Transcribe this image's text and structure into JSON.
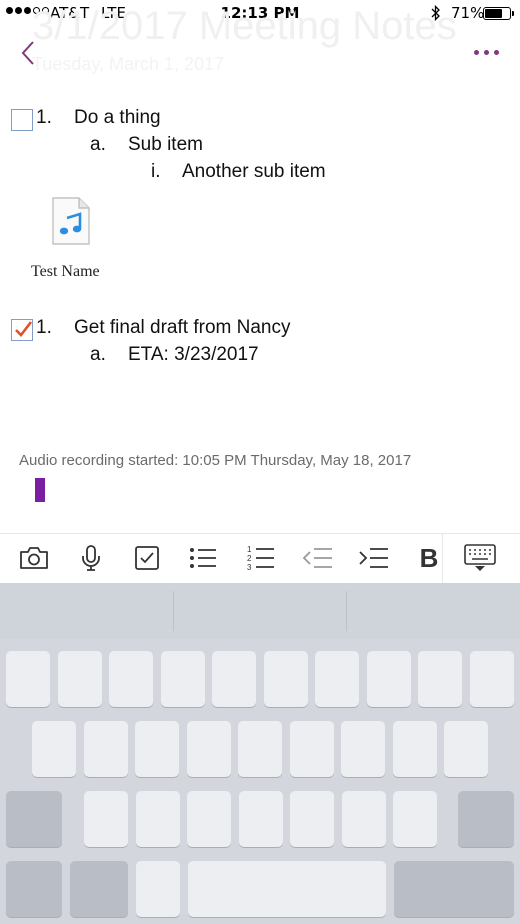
{
  "status_bar": {
    "carrier": "AT&T",
    "network": "LTE",
    "time": "12:13 PM",
    "battery_percent": "71%",
    "battery_level": 0.71,
    "bluetooth_icon": "bluetooth-icon"
  },
  "page": {
    "ghost_title": "3/1/2017 Meeting Notes",
    "ghost_subtitle": "Tuesday, March 1, 2017"
  },
  "nav": {
    "back_icon": "chevron-left-icon",
    "more_icon": "ellipsis-icon",
    "accent_color": "#80397b"
  },
  "note": {
    "todo1": {
      "number": "1.",
      "text": "Do a thing",
      "checked": false
    },
    "sub_a": {
      "marker": "a.",
      "text": "Sub item"
    },
    "sub_i": {
      "marker": "i.",
      "text": "Another sub item"
    },
    "attachment": {
      "icon": "audio-file-icon",
      "name": "Test Name"
    },
    "todo2": {
      "number": "1.",
      "text": "Get final draft from Nancy",
      "checked": true
    },
    "todo2_sub": {
      "marker": "a.",
      "text": "ETA: 3/23/2017"
    },
    "audio_status": "Audio recording started: 10:05 PM Thursday, May 18, 2017",
    "cursor_color": "#7a1fa2"
  },
  "toolbar": {
    "items": [
      "camera-icon",
      "microphone-icon",
      "checkbox-icon",
      "bullet-list-icon",
      "numbered-list-icon",
      "outdent-icon",
      "indent-icon",
      "bold-icon",
      "keyboard-dismiss-icon"
    ],
    "bold_label": "B",
    "numbered_digits": [
      "1",
      "2",
      "3"
    ]
  }
}
